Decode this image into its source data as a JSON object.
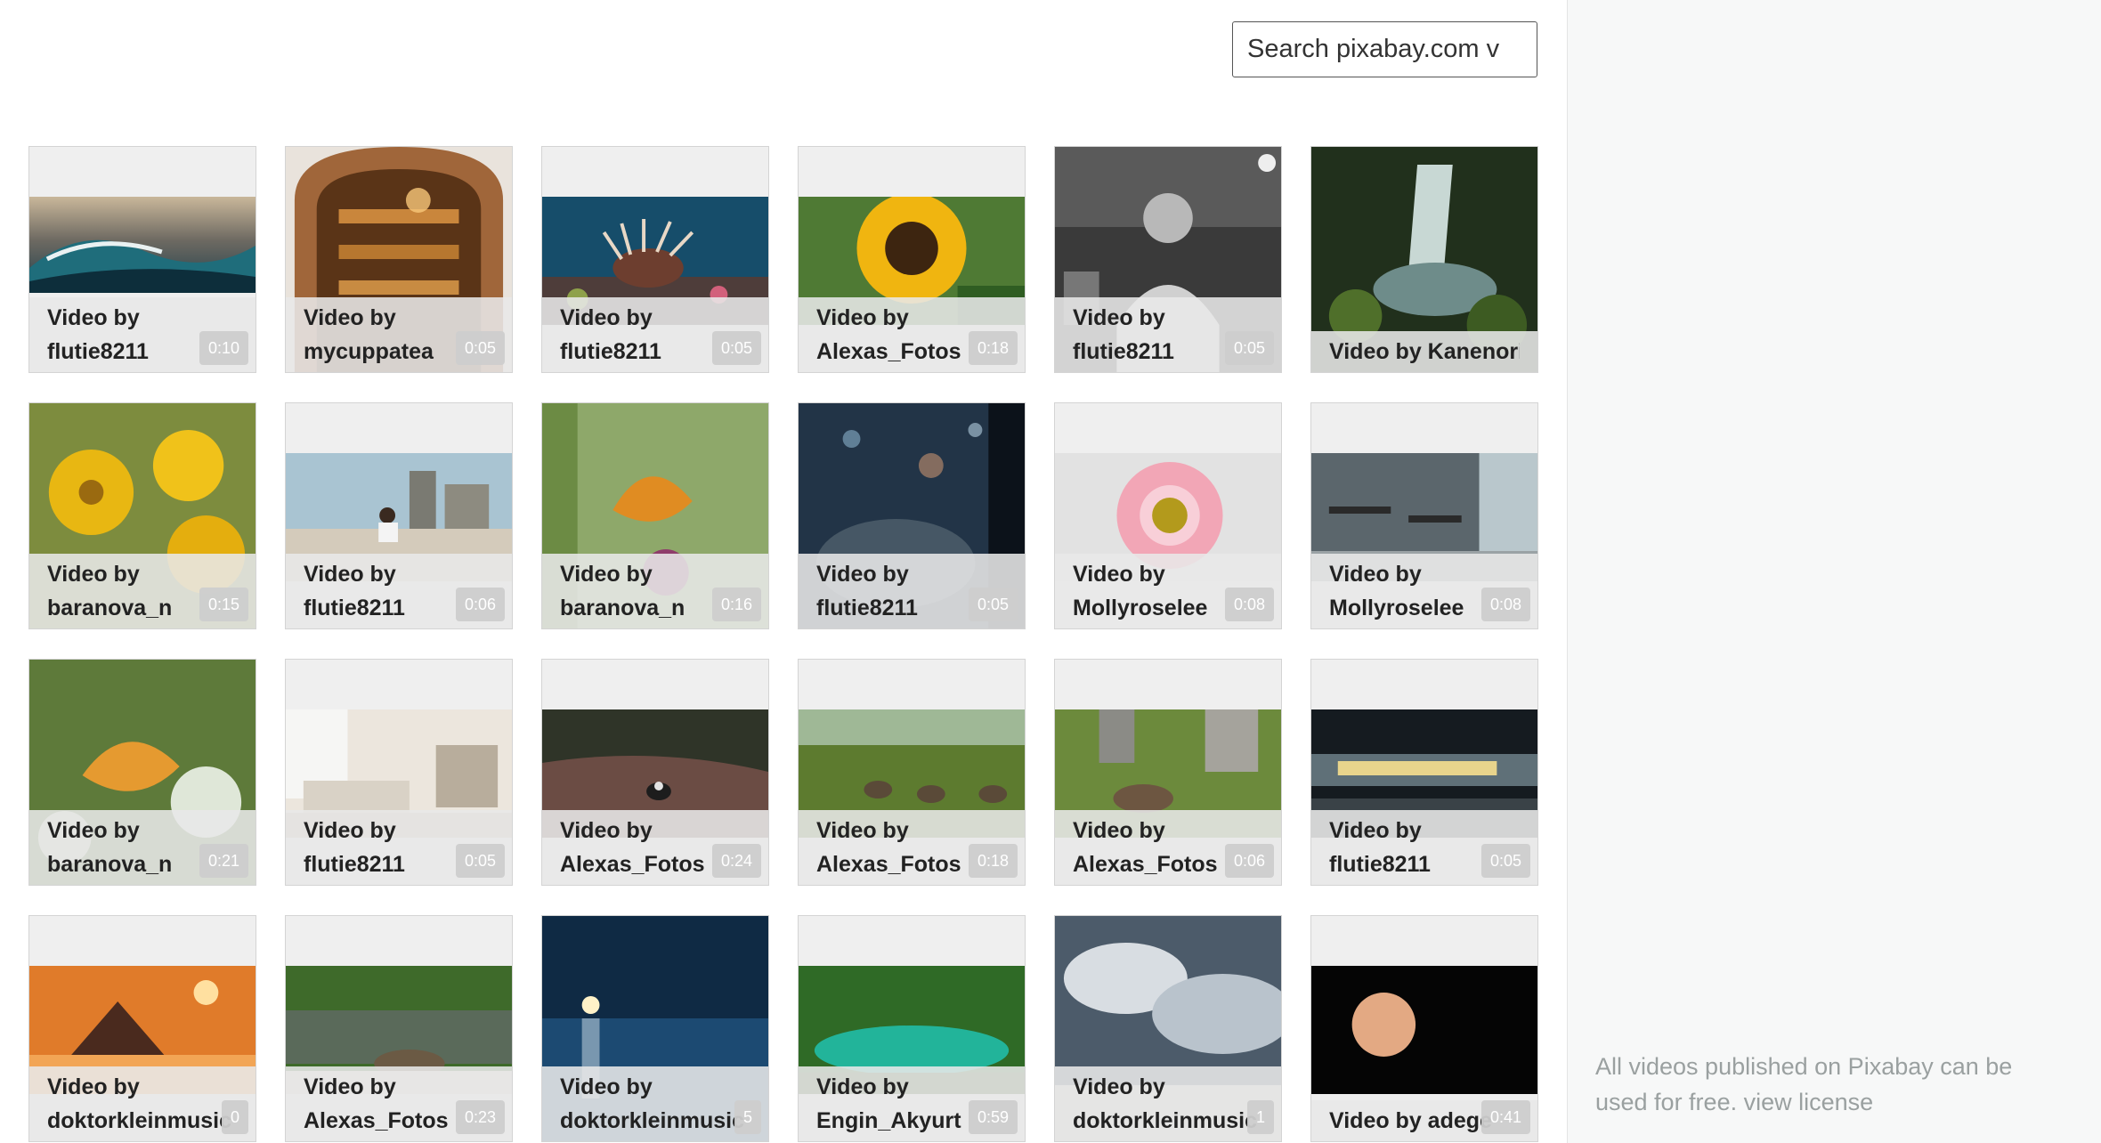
{
  "search": {
    "value": "Search pixabay.com v"
  },
  "license": {
    "text": "All videos published on Pixabay can be used for free.",
    "link_label": "view license"
  },
  "tiles": [
    {
      "caption": "Video by",
      "author": "flutie8211",
      "duration": "0:10",
      "subject": "wave"
    },
    {
      "caption": "Video by",
      "author": "mycuppatea",
      "duration": "0:05",
      "subject": "bread-library"
    },
    {
      "caption": "Video by",
      "author": "flutie8211",
      "duration": "0:05",
      "subject": "lionfish"
    },
    {
      "caption": "Video by",
      "author": "Alexas_Fotos",
      "duration": "0:18",
      "subject": "sunflower"
    },
    {
      "caption": "Video by",
      "author": "flutie8211",
      "duration": "0:05",
      "subject": "scientist"
    },
    {
      "caption": "Video by Kanenori",
      "author": "",
      "duration": "",
      "subject": "waterfall"
    },
    {
      "caption": "Video by",
      "author": "baranova_n",
      "duration": "0:15",
      "subject": "yellow-flowers"
    },
    {
      "caption": "Video by",
      "author": "flutie8211",
      "duration": "0:06",
      "subject": "rooftop"
    },
    {
      "caption": "Video by",
      "author": "baranova_n",
      "duration": "0:16",
      "subject": "butterfly"
    },
    {
      "caption": "Video by",
      "author": "flutie8211",
      "duration": "0:05",
      "subject": "rain-window"
    },
    {
      "caption": "Video by",
      "author": "Mollyroselee",
      "duration": "0:08",
      "subject": "pink-daisy"
    },
    {
      "caption": "Video by",
      "author": "Mollyroselee",
      "duration": "0:08",
      "subject": "cafe"
    },
    {
      "caption": "Video by",
      "author": "baranova_n",
      "duration": "0:21",
      "subject": "butterfly-thistle"
    },
    {
      "caption": "Video by",
      "author": "flutie8211",
      "duration": "0:05",
      "subject": "living-room"
    },
    {
      "caption": "Video by",
      "author": "Alexas_Fotos",
      "duration": "0:24",
      "subject": "duck-water"
    },
    {
      "caption": "Video by",
      "author": "Alexas_Fotos",
      "duration": "0:18",
      "subject": "geese-park"
    },
    {
      "caption": "Video by",
      "author": "Alexas_Fotos",
      "duration": "0:06",
      "subject": "goose-grass"
    },
    {
      "caption": "Video by",
      "author": "flutie8211",
      "duration": "0:05",
      "subject": "train"
    },
    {
      "caption": "Video by",
      "author": "doktorkleinmusic",
      "duration": "0",
      "subject": "mountain-sunset"
    },
    {
      "caption": "Video by",
      "author": "Alexas_Fotos",
      "duration": "0:23",
      "subject": "goose-lake"
    },
    {
      "caption": "Video by",
      "author": "doktorkleinmusic",
      "duration": "5",
      "subject": "moon-sea"
    },
    {
      "caption": "Video by",
      "author": "Engin_Akyurt",
      "duration": "0:59",
      "subject": "lagoon"
    },
    {
      "caption": "Video by",
      "author": "doktorkleinmusic",
      "duration": "1",
      "subject": "clouds"
    },
    {
      "caption": "Video by adege",
      "author": "",
      "duration": "0:41",
      "subject": "eclipse"
    }
  ],
  "colors": {
    "caption_bg": "#e8e8e8",
    "sidebar_bg": "#f7f8f8",
    "license_text": "#9aa0a0"
  }
}
